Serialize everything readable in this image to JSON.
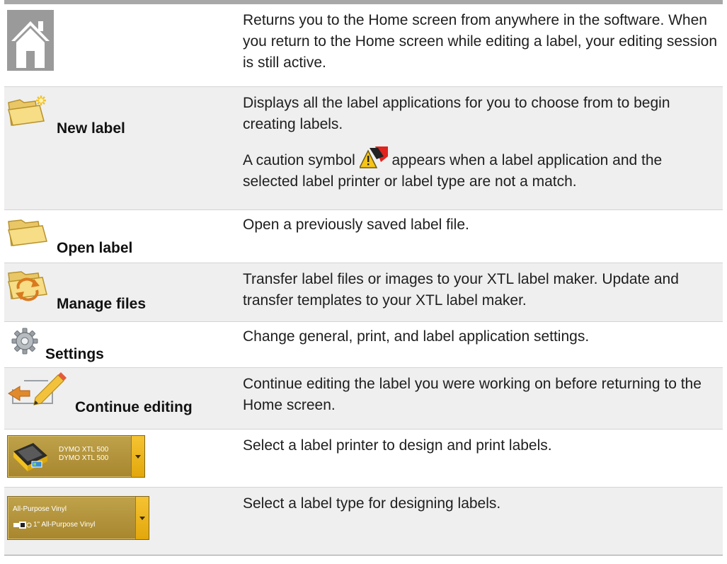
{
  "rows": [
    {
      "label": "",
      "icon": "home-icon",
      "description": [
        "Returns you to the Home screen from anywhere in the software. When you return to the Home screen while editing a label, your editing session is still active."
      ]
    },
    {
      "label": "New label",
      "icon": "new-folder-icon",
      "description": [
        "Displays all the label applications for you to choose from to begin creating labels.",
        "A caution symbol",
        "appears when a label application and the selected label printer or label type are not a match."
      ]
    },
    {
      "label": "Open label",
      "icon": "open-folder-icon",
      "description": [
        "Open a previously saved label file."
      ]
    },
    {
      "label": "Manage files",
      "icon": "sync-folder-icon",
      "description": [
        "Transfer label files or images to your XTL label maker. Update and transfer templates to your XTL label maker."
      ]
    },
    {
      "label": "Settings",
      "icon": "gear-icon",
      "description": [
        "Change general, print, and label application settings."
      ]
    },
    {
      "label": "Continue editing",
      "icon": "edit-pencil-icon",
      "description": [
        "Continue editing the label you were working on before returning to the Home screen."
      ]
    },
    {
      "label": "",
      "icon": "printer-icon",
      "dropdown": {
        "line1": "DYMO XTL 500",
        "line2": "DYMO XTL 500"
      },
      "description": [
        "Select a label printer to design and print labels."
      ]
    },
    {
      "label": "",
      "icon": "label-cartridge-icon",
      "dropdown": {
        "line1": "All-Purpose Vinyl",
        "line2": "1\" All-Purpose Vinyl"
      },
      "description": [
        "Select a label type for designing labels."
      ]
    }
  ],
  "colors": {
    "row_shade": "#efefef",
    "dropdown_gold": "#a7862e",
    "arrow_yellow": "#f2b820",
    "top_rule": "#a8a8a8"
  }
}
